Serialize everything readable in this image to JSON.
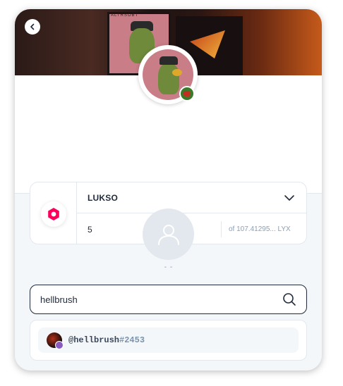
{
  "header": {
    "back_button": "chevron-left-icon",
    "banner_art_label": "ALTRSOBT"
  },
  "token": {
    "name": "LUKSO",
    "amount": "5",
    "balance": "of 107.41295... LYX",
    "logo_color": "#fe005b"
  },
  "recipient": {
    "name_placeholder": "- -"
  },
  "search": {
    "value": "hellbrush"
  },
  "results": [
    {
      "handle": "@hellbrush",
      "id": "#2453"
    }
  ]
}
